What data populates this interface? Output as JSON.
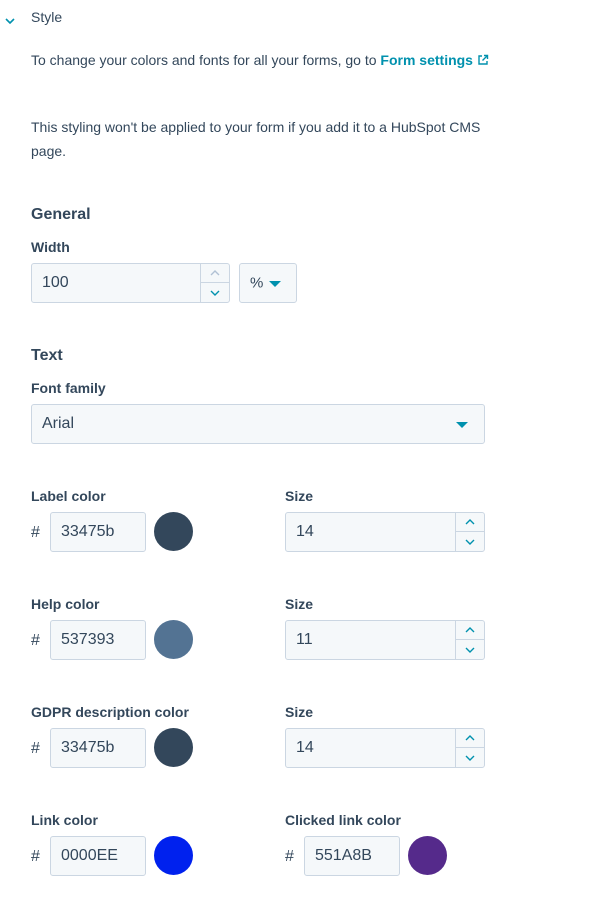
{
  "section": {
    "title": "Style"
  },
  "intro": {
    "text_before": "To change your colors and fonts for all your forms, go to ",
    "link_label": "Form settings",
    "note": "This styling won't be applied to your form if you add it to a HubSpot CMS page."
  },
  "general": {
    "heading": "General",
    "width_label": "Width",
    "width_value": "100",
    "unit_value": "%"
  },
  "text": {
    "heading": "Text",
    "font_family_label": "Font family",
    "font_family_value": "Arial"
  },
  "colors": {
    "hash": "#",
    "label_color": {
      "label": "Label color",
      "value": "33475b",
      "swatch": "#33475b"
    },
    "label_size": {
      "label": "Size",
      "value": "14"
    },
    "help_color": {
      "label": "Help color",
      "value": "537393",
      "swatch": "#537393"
    },
    "help_size": {
      "label": "Size",
      "value": "11"
    },
    "gdpr_color": {
      "label": "GDPR description color",
      "value": "33475b",
      "swatch": "#33475b"
    },
    "gdpr_size": {
      "label": "Size",
      "value": "14"
    },
    "link_color": {
      "label": "Link color",
      "value": "0000EE",
      "swatch": "#0000EE"
    },
    "clicked_link_color": {
      "label": "Clicked link color",
      "value": "551A8B",
      "swatch": "#551A8B"
    }
  },
  "icons": {
    "chevron": "chevron-down-icon",
    "external": "external-link-icon",
    "caret": "caret-down-icon",
    "stepper_up": "chevron-up-icon",
    "stepper_down": "chevron-down-icon"
  },
  "accent_color": "#0091ae"
}
